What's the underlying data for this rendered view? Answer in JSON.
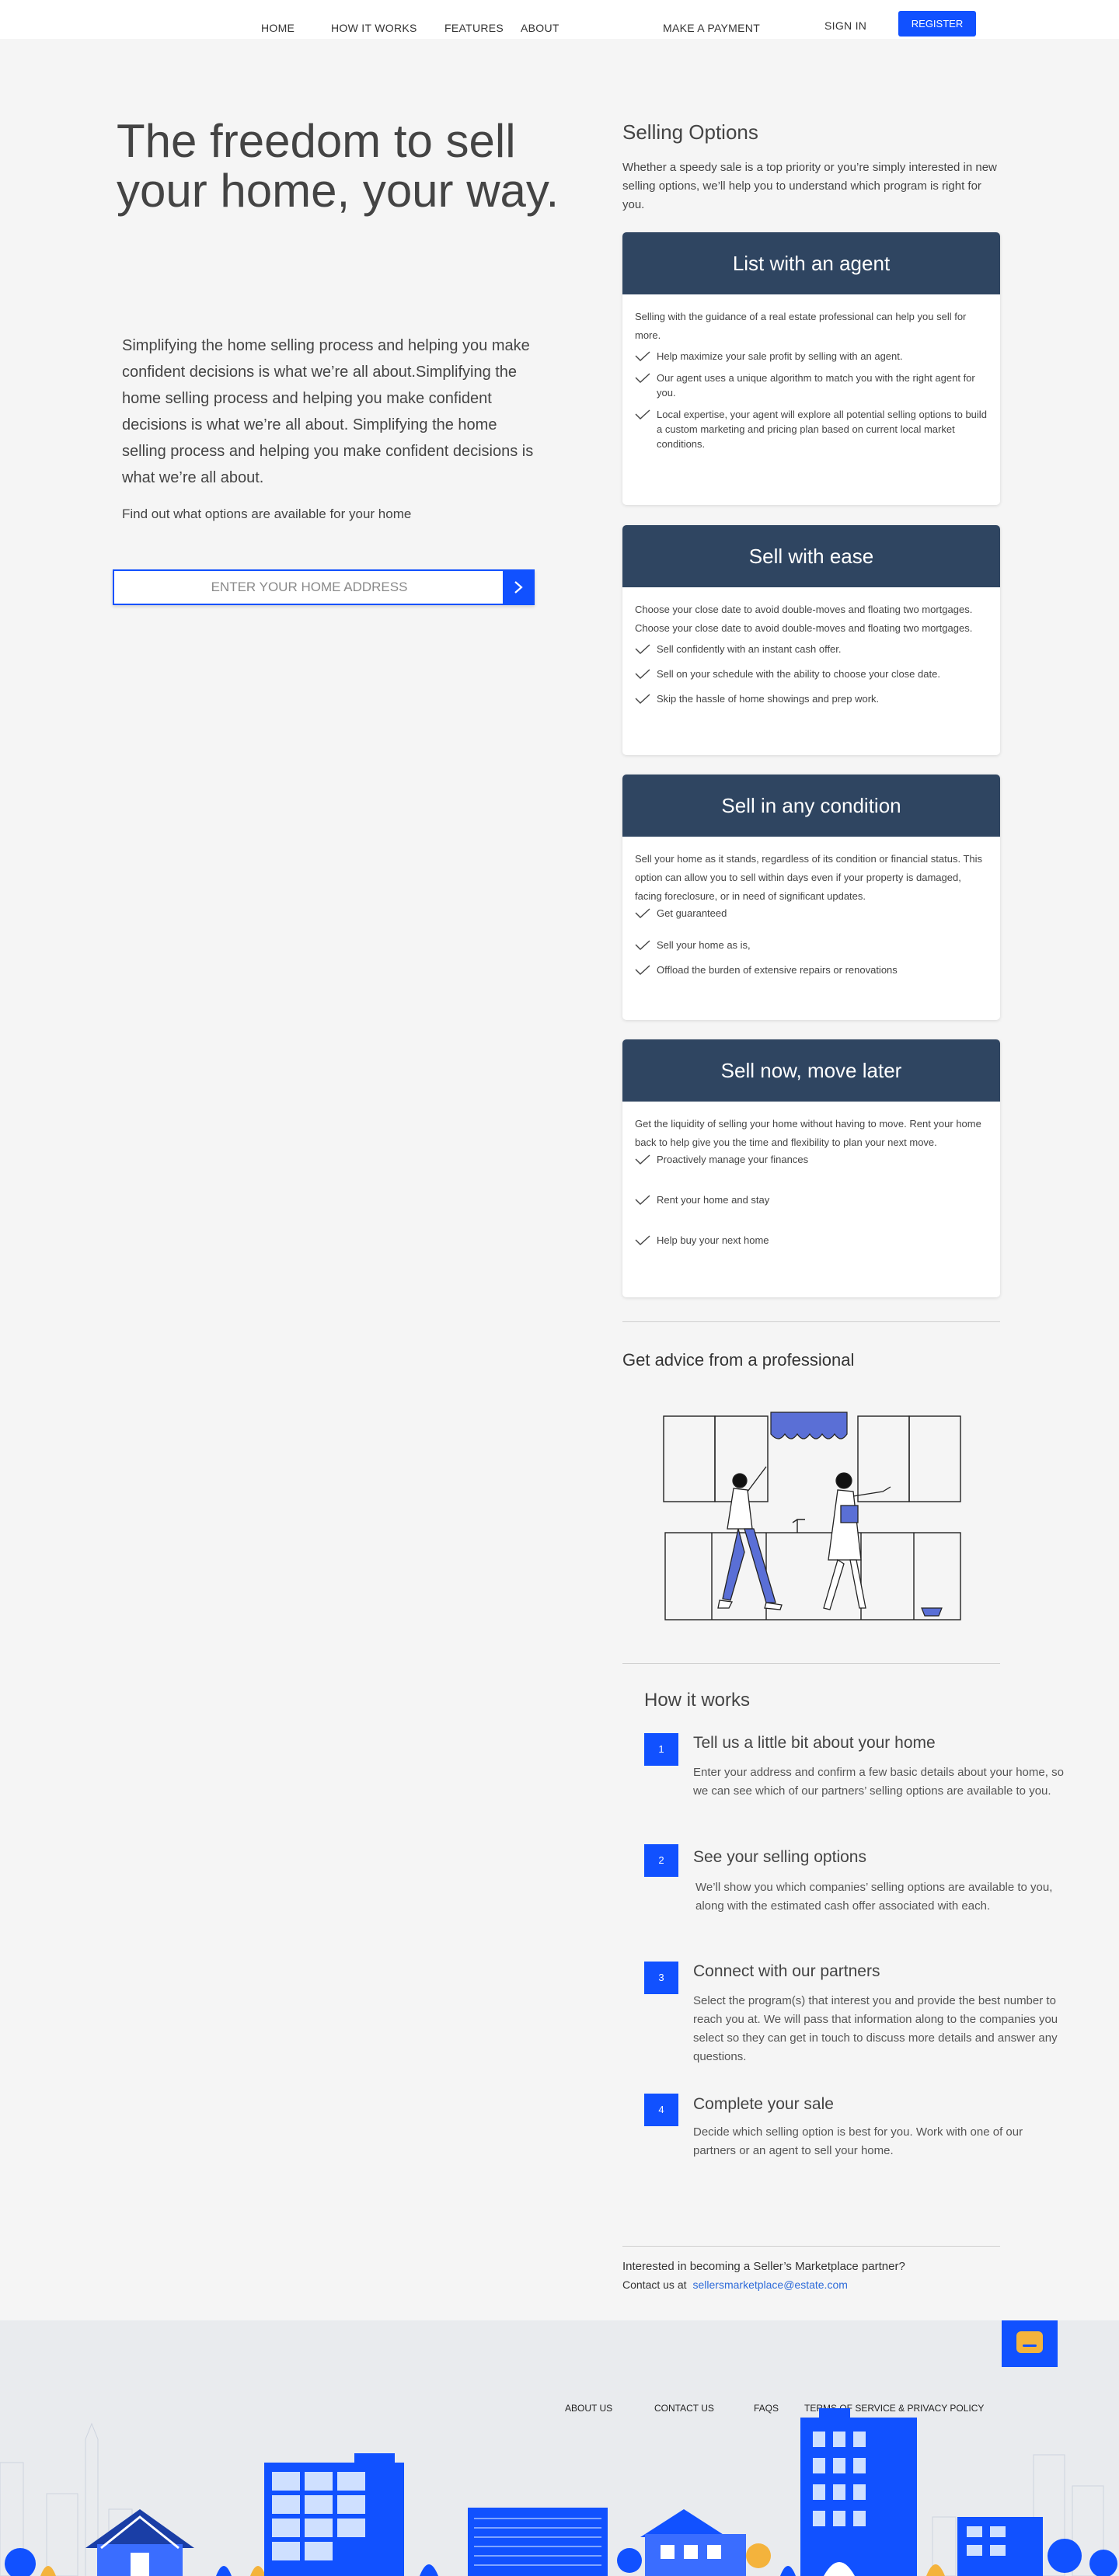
{
  "nav": {
    "home": "HOME",
    "how_it_works": "HOW IT WORKS",
    "features": "FEATURES",
    "about": "ABOUT",
    "make_payment": "MAKE A PAYMENT",
    "sign_in": "SIGN IN",
    "register": "REGISTER"
  },
  "hero": {
    "title": "The freedom to sell your home, your way.",
    "body": "Simplifying the home selling process and helping you make confident decisions is what we’re all about.Simplifying the home selling process and helping you make confident decisions is what we’re all about. Simplifying the home selling process and helping you make confident decisions is what we’re all about.",
    "find_out": "Find out what options are available for your home",
    "address_placeholder": "ENTER YOUR HOME ADDRESS"
  },
  "selling_options": {
    "title": "Selling Options",
    "intro": "Whether a speedy sale is a top priority or you’re simply interested in new selling options, we’ll help you to understand which program is right for you.",
    "cards": [
      {
        "title": "List with an agent",
        "desc": "Selling with the guidance of a real estate professional can help you sell for more.",
        "items": [
          "Help maximize your sale profit by selling with an agent.",
          "Our agent uses a unique algorithm to match you with the right agent for you.",
          "Local expertise, your agent will explore all potential selling options to build a custom marketing and pricing plan based on current local market conditions."
        ]
      },
      {
        "title": "Sell with ease",
        "desc": "Choose your close date to avoid double-moves and floating two mortgages. Choose your close date to avoid double-moves and floating two mortgages.",
        "items": [
          "Sell confidently with an instant cash offer.",
          "Sell on your schedule with the ability to choose your close date.",
          "Skip the hassle of home showings and prep work."
        ]
      },
      {
        "title": "Sell in any condition",
        "desc": "Sell your home as it stands, regardless of its condition or financial status. This option can allow you to sell within days even if your property is damaged, facing foreclosure, or in need of significant updates.",
        "items": [
          "Get guaranteed",
          "Sell your home as is,",
          "Offload the burden of extensive repairs or renovations"
        ]
      },
      {
        "title": "Sell now, move later",
        "desc": "Get the liquidity of selling your home without having to move. Rent your home back to help give you the time and flexibility to plan your next move.",
        "items": [
          "Proactively manage your finances",
          "Rent your home and stay",
          "Help buy your next home"
        ]
      }
    ]
  },
  "advice": {
    "title": "Get advice from a professional"
  },
  "how_it_works": {
    "title": "How it works",
    "steps": [
      {
        "num": "1",
        "title": "Tell us a little bit about your home",
        "text": "Enter your address and confirm a few basic details about your home, so we can see which of our partners’ selling options are available to you."
      },
      {
        "num": "2",
        "title": "See your selling options",
        "text": "We’ll show you which companies’ selling options are available to you, along with the estimated cash offer associated with each."
      },
      {
        "num": "3",
        "title": "Connect with our partners",
        "text": "Select the program(s) that interest you and provide the best number to reach you at. We will pass that information along to the companies you select so they can get in touch to discuss more details and answer any questions."
      },
      {
        "num": "4",
        "title": "Complete your sale",
        "text": "Decide which selling option is best for you. Work with one of our partners or an agent to sell your home."
      }
    ]
  },
  "partner": {
    "question": "Interested in becoming a Seller’s Marketplace partner?",
    "contact_label": "Contact us at",
    "email": "sellersmarketplace@estate.com"
  },
  "footer": {
    "about_us": "ABOUT US",
    "contact_us": "CONTACT US",
    "faqs": "FAQS",
    "terms": "TERMS OF SERVICE & PRIVACY POLICY"
  },
  "colors": {
    "accent": "#1151ff",
    "card_header": "#2f4561",
    "chat_icon": "#f4b33c",
    "link": "#2e6bd9"
  }
}
